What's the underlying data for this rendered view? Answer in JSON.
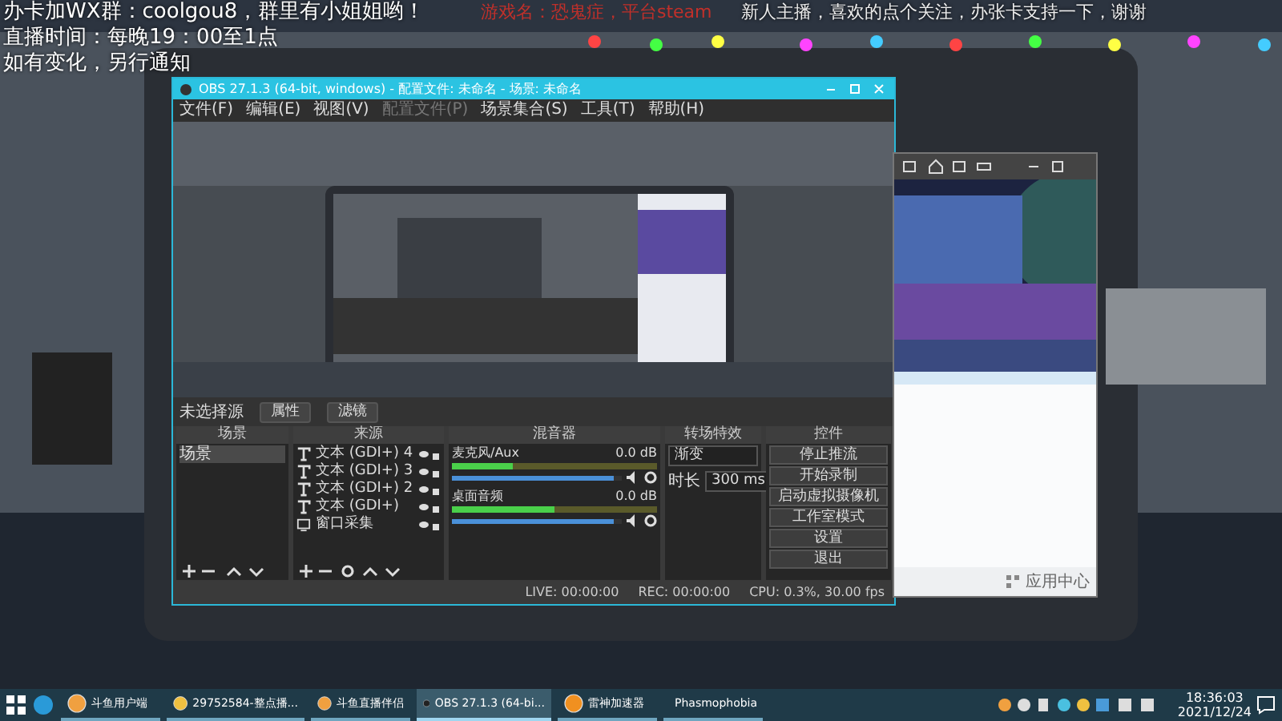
{
  "overlay": {
    "lines": [
      "办卡加WX群：coolgou8，群里有小姐姐哟！",
      "直播时间：每晚19：00至1点",
      "如有变化，另行通知"
    ],
    "banner": "游戏名：恐鬼症，平台steam",
    "notice": "新人主播，喜欢的点个关注，办张卡支持一下，谢谢"
  },
  "obs": {
    "title": "OBS 27.1.3 (64-bit, windows) - 配置文件: 未命名 - 场景: 未命名",
    "menu": [
      {
        "label": "文件(F)",
        "disabled": false
      },
      {
        "label": "编辑(E)",
        "disabled": false
      },
      {
        "label": "视图(V)",
        "disabled": false
      },
      {
        "label": "配置文件(P)",
        "disabled": true
      },
      {
        "label": "场景集合(S)",
        "disabled": false
      },
      {
        "label": "工具(T)",
        "disabled": false
      },
      {
        "label": "帮助(H)",
        "disabled": false
      }
    ],
    "source_bar": {
      "label": "未选择源",
      "buttons": [
        "属性",
        "滤镜"
      ]
    },
    "scenes": {
      "title": "场景",
      "items": [
        {
          "label": "场景",
          "selected": true
        }
      ]
    },
    "sources": {
      "title": "来源",
      "items": [
        {
          "label": "文本 (GDI+) 4",
          "kind": "text"
        },
        {
          "label": "文本 (GDI+) 3",
          "kind": "text"
        },
        {
          "label": "文本 (GDI+) 2",
          "kind": "text"
        },
        {
          "label": "文本 (GDI+)",
          "kind": "text"
        },
        {
          "label": "窗口采集",
          "kind": "window"
        }
      ]
    },
    "mixer": {
      "title": "混音器",
      "channels": [
        {
          "name": "麦克风/Aux",
          "reading": "0.0 dB",
          "meter": {
            "level": 0.3
          },
          "fader": {
            "level": 0.95
          }
        },
        {
          "name": "桌面音频",
          "reading": "0.0 dB",
          "meter": {
            "level": 0.5
          },
          "fader": {
            "level": 0.95
          }
        }
      ]
    },
    "transitions": {
      "title": "转场特效",
      "type": "渐变",
      "duration_label": "时长",
      "duration": "300 ms"
    },
    "controls": {
      "title": "控件",
      "buttons": [
        "停止推流",
        "开始录制",
        "启动虚拟摄像机",
        "工作室模式",
        "设置",
        "退出"
      ]
    },
    "status": [
      "LIVE: 00:00:00",
      "REC: 00:00:00",
      "CPU: 0.3%, 30.00 fps"
    ]
  },
  "side_app": {
    "footer": "应用中心"
  },
  "taskbar": {
    "items": [
      {
        "label": "斗鱼用户端",
        "kind": "doc",
        "selected": false
      },
      {
        "label": "29752584-整点播...",
        "kind": "chat",
        "selected": false
      },
      {
        "label": "斗鱼直播伴侣",
        "kind": "doc",
        "selected": false
      },
      {
        "label": "OBS 27.1.3 (64-bi...",
        "kind": "obs",
        "selected": true
      },
      {
        "label": "雷神加速器",
        "kind": "orb",
        "selected": false
      },
      {
        "label": "Phasmophobia",
        "kind": "game",
        "selected": false
      }
    ],
    "time": "18:36:03",
    "date": "2021/12/24"
  }
}
